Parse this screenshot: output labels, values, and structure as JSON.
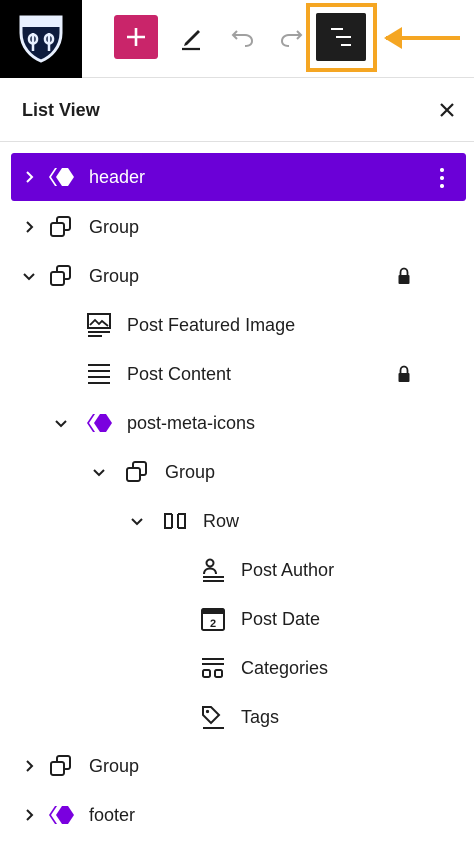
{
  "toolbar": {
    "logo_icon": "route-66-logo",
    "add_icon": "plus-icon",
    "edit_icon": "pencil-icon",
    "undo_icon": "undo-icon",
    "redo_icon": "redo-icon",
    "list_view_icon": "list-view-icon",
    "annotation_color": "#f5a623",
    "add_color": "#c9256a"
  },
  "panel": {
    "title": "List View",
    "close_icon": "close-icon"
  },
  "tree": [
    {
      "label": "header",
      "icon": "template-part-icon",
      "expand": "collapsed",
      "selected": true,
      "locked": false,
      "has_options": true
    },
    {
      "label": "Group",
      "icon": "group-icon",
      "expand": "collapsed",
      "selected": false,
      "locked": false
    },
    {
      "label": "Group",
      "icon": "group-icon",
      "expand": "expanded",
      "selected": false,
      "locked": true
    },
    {
      "label": "Post Featured Image",
      "icon": "featured-image-icon",
      "expand": "none",
      "selected": false,
      "locked": false
    },
    {
      "label": "Post Content",
      "icon": "post-content-icon",
      "expand": "none",
      "selected": false,
      "locked": true
    },
    {
      "label": "post-meta-icons",
      "icon": "template-part-icon",
      "expand": "expanded",
      "selected": false,
      "locked": false
    },
    {
      "label": "Group",
      "icon": "group-icon",
      "expand": "expanded",
      "selected": false,
      "locked": false
    },
    {
      "label": "Row",
      "icon": "row-icon",
      "expand": "expanded",
      "selected": false,
      "locked": false
    },
    {
      "label": "Post Author",
      "icon": "post-author-icon",
      "expand": "none",
      "selected": false,
      "locked": false
    },
    {
      "label": "Post Date",
      "icon": "post-date-icon",
      "expand": "none",
      "selected": false,
      "locked": false
    },
    {
      "label": "Categories",
      "icon": "categories-icon",
      "expand": "none",
      "selected": false,
      "locked": false
    },
    {
      "label": "Tags",
      "icon": "tags-icon",
      "expand": "none",
      "selected": false,
      "locked": false
    },
    {
      "label": "Group",
      "icon": "group-icon",
      "expand": "collapsed",
      "selected": false,
      "locked": false
    },
    {
      "label": "footer",
      "icon": "template-part-icon",
      "expand": "collapsed",
      "selected": false,
      "locked": false
    }
  ],
  "colors": {
    "selected_bg": "#6b00d7",
    "template_part": "#7a00df",
    "text": "#1e1e1e"
  }
}
